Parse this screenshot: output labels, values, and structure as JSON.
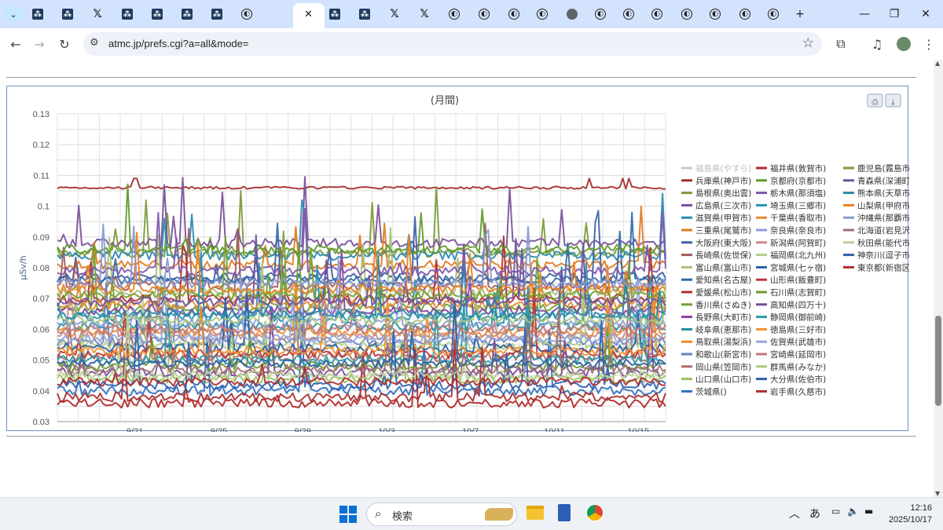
{
  "browser": {
    "tabs": [
      {
        "icon": "site"
      },
      {
        "icon": "site"
      },
      {
        "icon": "x"
      },
      {
        "icon": "site"
      },
      {
        "icon": "site"
      },
      {
        "icon": "site"
      },
      {
        "icon": "site"
      },
      {
        "icon": "circle"
      },
      {
        "icon": "active"
      },
      {
        "icon": "site"
      },
      {
        "icon": "site"
      },
      {
        "icon": "site"
      },
      {
        "icon": "x"
      },
      {
        "icon": "x"
      },
      {
        "icon": "circle"
      },
      {
        "icon": "circle"
      },
      {
        "icon": "circle"
      },
      {
        "icon": "circle"
      },
      {
        "icon": "globe"
      },
      {
        "icon": "circle"
      },
      {
        "icon": "circle"
      },
      {
        "icon": "circle"
      },
      {
        "icon": "circle"
      },
      {
        "icon": "circle"
      },
      {
        "icon": "circle"
      },
      {
        "icon": "circle"
      }
    ],
    "url": "atmc.jp/prefs.cgi?a=all&mode="
  },
  "chart_data": {
    "type": "line",
    "title": "(月間)",
    "ylabel": "μSv/h",
    "ylim": [
      0.03,
      0.13
    ],
    "yticks": [
      "0.13",
      "0.12",
      "0.11",
      "0.1",
      "0.09",
      "0.08",
      "0.07",
      "0.06",
      "0.05",
      "0.04",
      "0.03"
    ],
    "xticks": [
      "9/21",
      "9/25",
      "9/29",
      "10/3",
      "10/7",
      "10/11",
      "10/15"
    ],
    "grid": true,
    "legend_position": "right",
    "series": [
      {
        "name": "福島県(やすら)",
        "color": "#c8c8c8",
        "base": null
      },
      {
        "name": "兵庫県(神戸市)",
        "color": "#a52a2a",
        "base": 0.106
      },
      {
        "name": "島根県(奥出雲)",
        "color": "#7b9a3a",
        "base": 0.085
      },
      {
        "name": "広島県(三次市)",
        "color": "#7a4f9a",
        "base": 0.088
      },
      {
        "name": "滋賀県(甲賀市)",
        "color": "#2a8ab0",
        "base": 0.084
      },
      {
        "name": "三重県(尾鷲市)",
        "color": "#e07b1f",
        "base": 0.081
      },
      {
        "name": "大阪府(東大阪)",
        "color": "#3e5fa6",
        "base": 0.077
      },
      {
        "name": "長崎県(佐世保)",
        "color": "#a05a5a",
        "base": 0.074
      },
      {
        "name": "富山県(富山市)",
        "color": "#a8bf7a",
        "base": 0.072
      },
      {
        "name": "愛知県(名古屋)",
        "color": "#2e6aa8",
        "base": 0.076
      },
      {
        "name": "愛媛県(松山市)",
        "color": "#b03030",
        "base": 0.07
      },
      {
        "name": "香川県(さぬき)",
        "color": "#6f9f2f",
        "base": 0.067
      },
      {
        "name": "長野県(大町市)",
        "color": "#8a3f9f",
        "base": 0.066
      },
      {
        "name": "岐阜県(恵那市)",
        "color": "#1f8fa0",
        "base": 0.061
      },
      {
        "name": "鳥取県(湯梨浜)",
        "color": "#f08a24",
        "base": 0.059
      },
      {
        "name": "和歌山(新宮市)",
        "color": "#6a7fc0",
        "base": 0.056
      },
      {
        "name": "岡山県(笠岡市)",
        "color": "#b06a6a",
        "base": 0.051
      },
      {
        "name": "山口県(山口市)",
        "color": "#9ac060",
        "base": 0.044
      },
      {
        "name": "茨城県()",
        "color": "#2f70c0",
        "base": 0.04
      },
      {
        "name": "福井県(敦賀市)",
        "color": "#b02828",
        "base": 0.036
      },
      {
        "name": "京都府(京都市)",
        "color": "#5f9a2a",
        "base": 0.086
      },
      {
        "name": "栃木県(那須塩)",
        "color": "#7f55a8",
        "base": 0.079
      },
      {
        "name": "埼玉県(三郷市)",
        "color": "#2594b0",
        "base": 0.064
      },
      {
        "name": "千葉県(香取市)",
        "color": "#e48a2e",
        "base": 0.068
      },
      {
        "name": "奈良県(奈良市)",
        "color": "#8aa0d8",
        "base": 0.062
      },
      {
        "name": "新潟県(阿賀町)",
        "color": "#c88a8a",
        "base": 0.058
      },
      {
        "name": "福岡県(北九州)",
        "color": "#b5cc8a",
        "base": 0.055
      },
      {
        "name": "宮城県(七ヶ宿)",
        "color": "#2a5fa0",
        "base": 0.054
      },
      {
        "name": "山形県(飯豊町)",
        "color": "#b83838",
        "base": 0.052
      },
      {
        "name": "石川県(志賀町)",
        "color": "#6a9a30",
        "base": 0.048
      },
      {
        "name": "高知県(四万十)",
        "color": "#7a4a98",
        "base": 0.046
      },
      {
        "name": "静岡県(御前崎)",
        "color": "#2a98a8",
        "base": 0.05
      },
      {
        "name": "徳島県(三好市)",
        "color": "#f09030",
        "base": 0.053
      },
      {
        "name": "佐賀県(武雄市)",
        "color": "#90a8d8",
        "base": 0.057
      },
      {
        "name": "宮崎県(延岡市)",
        "color": "#c07878",
        "base": 0.06
      },
      {
        "name": "群馬県(みなか)",
        "color": "#a8c878",
        "base": 0.063
      },
      {
        "name": "大分県(佐伯市)",
        "color": "#2f60b0",
        "base": 0.042
      },
      {
        "name": "岩手県(久慈市)",
        "color": "#a83030",
        "base": 0.038
      },
      {
        "name": "鹿児島(霧島市)",
        "color": "#77a030",
        "base": 0.071
      },
      {
        "name": "青森県(深浦町)",
        "color": "#6f4f9f",
        "base": 0.069
      },
      {
        "name": "熊本県(天草市)",
        "color": "#2888a8",
        "base": 0.065
      },
      {
        "name": "山梨県(甲府市)",
        "color": "#e88020",
        "base": 0.073
      },
      {
        "name": "沖縄県(那覇市)",
        "color": "#8a98d0",
        "base": 0.075
      },
      {
        "name": "北海道(岩見沢)",
        "color": "#a07070",
        "base": 0.047
      },
      {
        "name": "秋田県(能代市)",
        "color": "#b8d090",
        "base": 0.045
      },
      {
        "name": "神奈川(逗子市)",
        "color": "#3060a0",
        "base": 0.049
      },
      {
        "name": "東京都(新宿区)",
        "color": "#b02c2c",
        "base": 0.043
      }
    ]
  },
  "taskbar": {
    "search_placeholder": "検索",
    "time": "12:16",
    "date": "2025/10/17",
    "ime": "あ"
  }
}
